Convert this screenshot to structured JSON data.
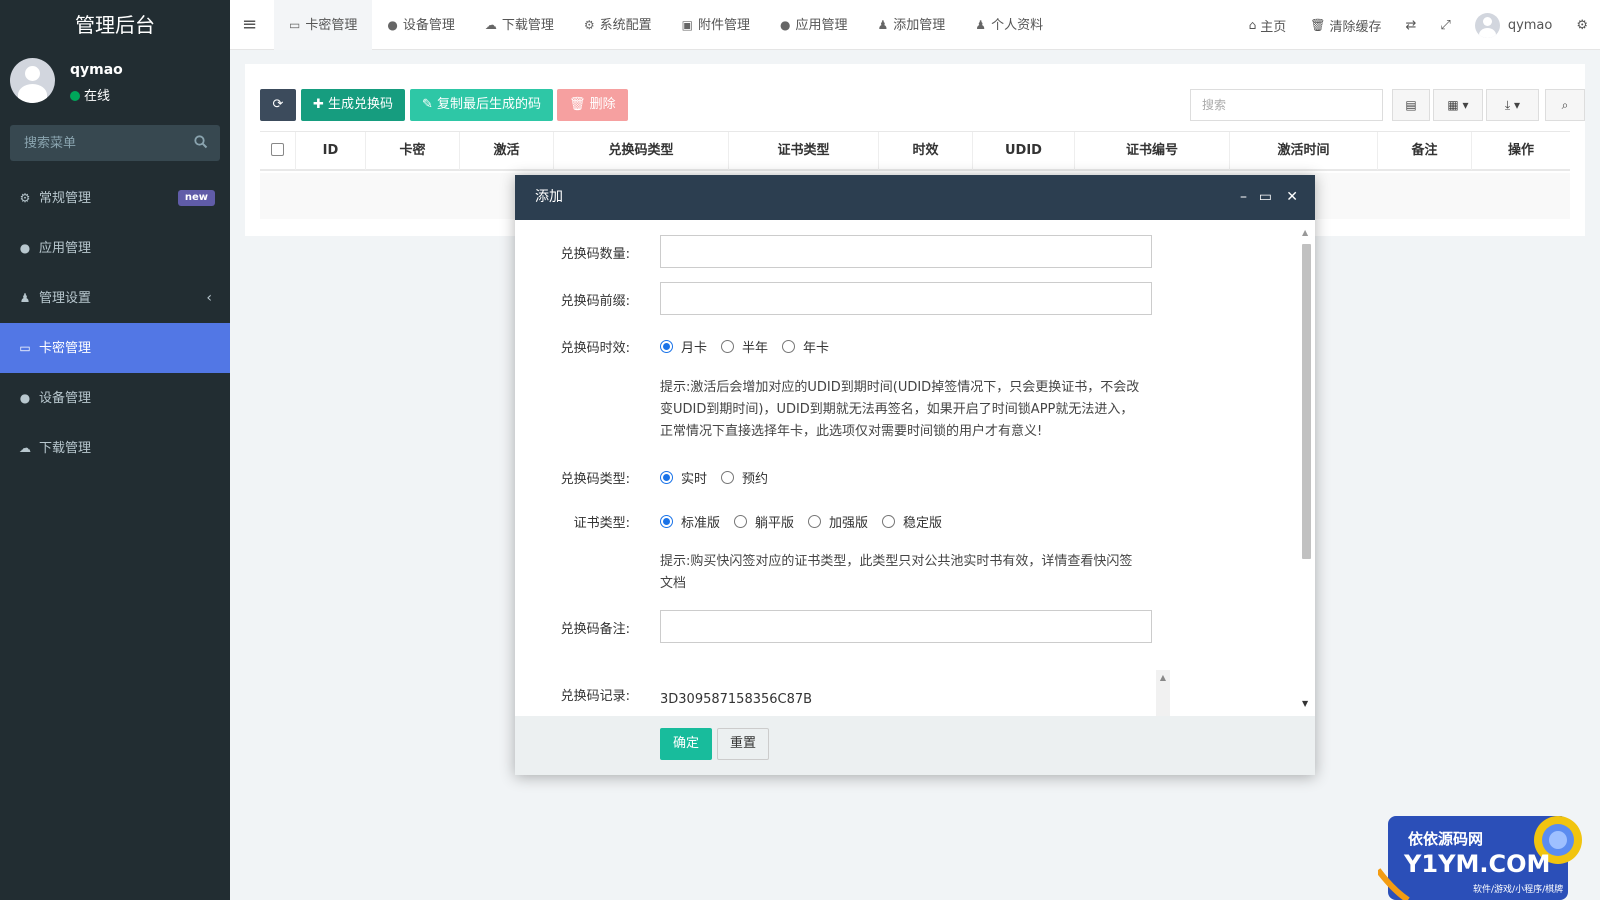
{
  "sidebar": {
    "logo": "管理后台",
    "user": {
      "name": "qymao",
      "status": "在线"
    },
    "search_placeholder": "搜索菜单",
    "items": [
      {
        "label": "常规管理",
        "icon": "cogs-icon",
        "badge": "new"
      },
      {
        "label": "应用管理",
        "icon": "app-store-icon"
      },
      {
        "label": "管理设置",
        "icon": "users-icon",
        "chevron": "‹"
      },
      {
        "label": "卡密管理",
        "icon": "credit-card-icon",
        "active": true
      },
      {
        "label": "设备管理",
        "icon": "apple-icon"
      },
      {
        "label": "下载管理",
        "icon": "cloud-download-icon"
      }
    ]
  },
  "header": {
    "tabs": [
      {
        "label": "卡密管理",
        "icon": "credit-card-icon",
        "active": true
      },
      {
        "label": "设备管理",
        "icon": "apple-icon"
      },
      {
        "label": "下载管理",
        "icon": "cloud-download-icon"
      },
      {
        "label": "系统配置",
        "icon": "gear-icon"
      },
      {
        "label": "附件管理",
        "icon": "image-icon"
      },
      {
        "label": "应用管理",
        "icon": "app-store-icon"
      },
      {
        "label": "添加管理",
        "icon": "user-icon"
      },
      {
        "label": "个人资料",
        "icon": "user-icon"
      }
    ],
    "right": {
      "home": "主页",
      "clear_cache": "清除缓存",
      "username": "qymao"
    }
  },
  "toolbar": {
    "generate": "生成兑换码",
    "copy_last": "复制最后生成的码",
    "delete": "删除",
    "search_placeholder": "搜索"
  },
  "table": {
    "columns": [
      "ID",
      "卡密",
      "激活",
      "兑换码类型",
      "证书类型",
      "时效",
      "UDID",
      "证书编号",
      "激活时间",
      "备注",
      "操作"
    ]
  },
  "modal": {
    "title": "添加",
    "fields": {
      "quantity_label": "兑换码数量:",
      "prefix_label": "兑换码前缀:",
      "validity_label": "兑换码时效:",
      "validity_options": [
        "月卡",
        "半年",
        "年卡"
      ],
      "validity_selected": 0,
      "validity_hint": "提示:激活后会增加对应的UDID到期时间(UDID掉签情况下，只会更换证书，不会改变UDID到期时间)，UDID到期就无法再签名，如果开启了时间锁APP就无法进入，正常情况下直接选择年卡，此选项仅对需要时间锁的用户才有意义!",
      "type_label": "兑换码类型:",
      "type_options": [
        "实时",
        "预约"
      ],
      "type_selected": 0,
      "cert_label": "证书类型:",
      "cert_options": [
        "标准版",
        "躺平版",
        "加强版",
        "稳定版"
      ],
      "cert_selected": 0,
      "cert_hint": "提示:购买快闪签对应的证书类型，此类型只对公共池实时书有效，详情查看快闪签文档",
      "remark_label": "兑换码备注:",
      "record_label": "兑换码记录:",
      "record_value": "3D309587158356C87B"
    },
    "buttons": {
      "ok": "确定",
      "reset": "重置"
    }
  },
  "watermark": {
    "line1": "依依源码网",
    "line2": "Y1YM.COM",
    "line3": "软件/游戏/小程序/棋牌"
  }
}
